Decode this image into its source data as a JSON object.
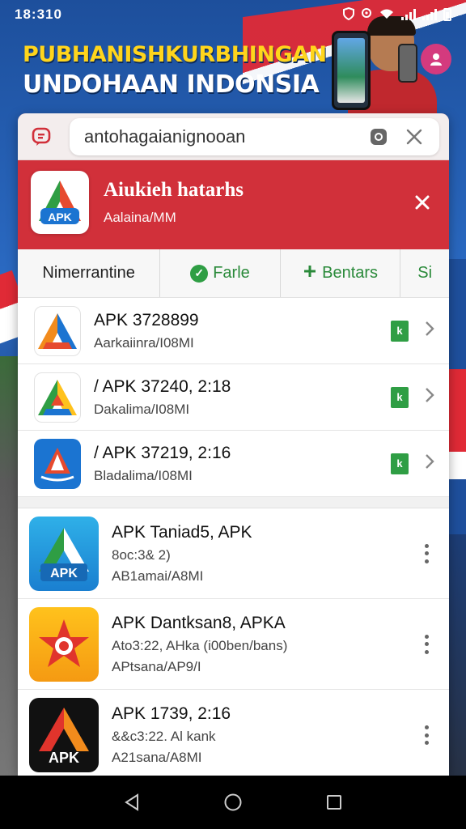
{
  "status_bar": {
    "time": "18:310"
  },
  "banner": {
    "line1": "PUBHANISHKURBHINGAN",
    "line2": "UNDOHAAN INDONSIA"
  },
  "search": {
    "value": "antohagaianignooan"
  },
  "app_header": {
    "title": "Aiukieh hatarhs",
    "subtitle": "Aalaina/MM",
    "logo_text": "APK",
    "accent": "#d1303a"
  },
  "filters": [
    {
      "label": "Nimerrantine",
      "icon": ""
    },
    {
      "label": "Farle",
      "icon": "check-circle-icon"
    },
    {
      "label": "Bentars",
      "icon": "plus-icon"
    },
    {
      "label": "Si",
      "icon": ""
    }
  ],
  "top_list": [
    {
      "title": "APK 3728899",
      "sub": "Aarkaiinra/I08MI",
      "badge": "k"
    },
    {
      "title": "/ APK 37240, 2:18",
      "sub": "Dakalima/I08MI",
      "badge": "k"
    },
    {
      "title": "/ APK 37219, 2:16",
      "sub": "Bladalima/I08MI",
      "badge": "k"
    }
  ],
  "bottom_list": [
    {
      "title": "APK Taniad5, APK",
      "line2": "8oc:3& 2)",
      "sub": "AB1amai/A8MI",
      "logo_text": "APK"
    },
    {
      "title": "APK Dantksan8, APKA",
      "line2": "Ato3:22, AHka (i00ben/bans)",
      "sub": "APtsana/AP9/I",
      "logo_text": ""
    },
    {
      "title": "APK 1739, 2:16",
      "line2": "&&c3:22. Al kank",
      "sub": "A21sana/A8MI",
      "logo_text": "APK"
    }
  ],
  "nav": {
    "back": "back-icon",
    "home": "home-icon",
    "recents": "recents-icon"
  }
}
